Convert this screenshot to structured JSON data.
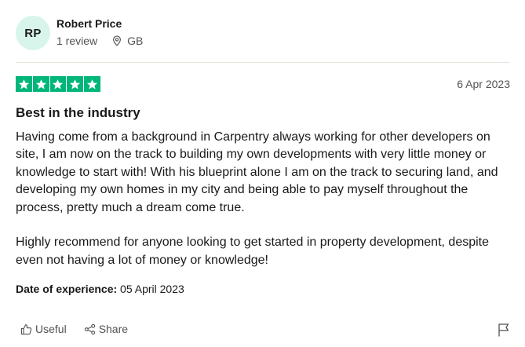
{
  "reviewer": {
    "initials": "RP",
    "name": "Robert Price",
    "review_count": "1 review",
    "country": "GB",
    "avatar_color": "#d7f5ea"
  },
  "rating": {
    "stars": 5,
    "max_stars": 5,
    "star_color": "#00b67a"
  },
  "review": {
    "date": "6 Apr 2023",
    "title": "Best in the industry",
    "paragraphs": [
      "Having come from a background in Carpentry always working for other developers on site, I am now on the track to building my own developments with very little money or knowledge to start with! With his blueprint alone I am on the track to securing land, and developing my own homes in my city and being able to pay myself throughout the process, pretty much a dream come true.",
      "Highly recommend for anyone looking to get started in property development, despite even not having a lot of money or knowledge!"
    ],
    "experience_label": "Date of experience:",
    "experience_date": " 05 April 2023"
  },
  "actions": {
    "useful_label": "Useful",
    "share_label": "Share",
    "useful_icon": "thumbs-up-icon",
    "share_icon": "share-icon",
    "flag_icon": "flag-icon"
  }
}
